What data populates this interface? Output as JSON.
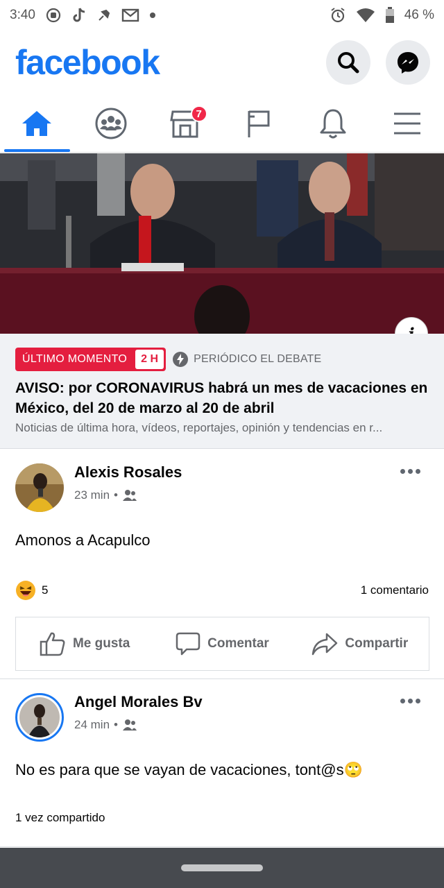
{
  "status_bar": {
    "time": "3:40",
    "battery": "46 %"
  },
  "header": {
    "logo": "facebook"
  },
  "tabs": {
    "marketplace_badge": "7"
  },
  "news": {
    "badge_label": "ÚLTIMO MOMENTO",
    "badge_time": "2 H",
    "source": "PERIÓDICO EL DEBATE",
    "title": "AVISO: por CORONAVIRUS habrá un mes de vacaciones en México, del 20 de marzo al 20 de abril",
    "description": "Noticias de última hora, vídeos, reportajes, opinión y tendencias en r..."
  },
  "posts": [
    {
      "author": "Alexis Rosales",
      "time": "23 min",
      "text": "Amonos a Acapulco",
      "reaction_count": "5",
      "comments": "1 comentario",
      "actions": {
        "like": "Me gusta",
        "comment": "Comentar",
        "share": "Compartir"
      }
    },
    {
      "author": "Angel Morales Bv",
      "time": "24 min",
      "text": "No es para que se vayan de vacaciones, tont@s🙄",
      "shares": "1 vez compartido"
    }
  ],
  "colors": {
    "brand": "#1877f2",
    "breaking": "#e41e3f"
  }
}
